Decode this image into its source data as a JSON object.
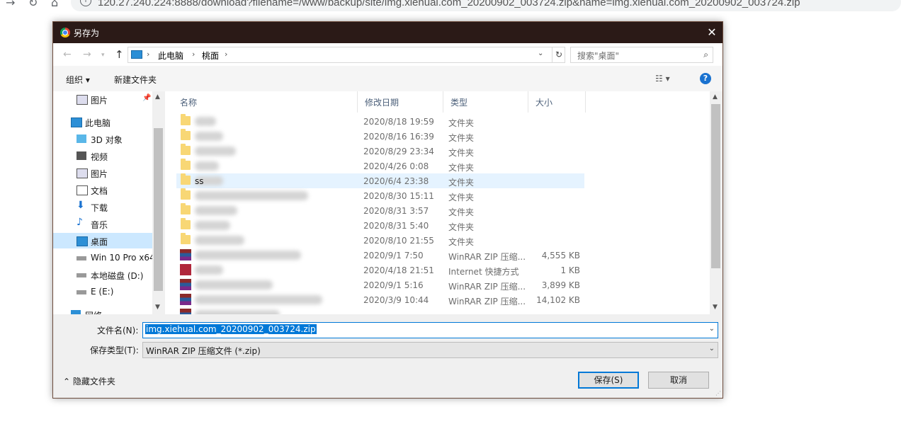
{
  "browser": {
    "url": "120.27.240.224:8888/download?filename=/www/backup/site/img.xiehual.com_20200902_003724.zip&name=img.xiehual.com_20200902_003724.zip",
    "info_icon": "i"
  },
  "dialog": {
    "title": "另存为",
    "close": "✕"
  },
  "address": {
    "crumbs": [
      "此电脑",
      "桃面"
    ],
    "search_placeholder": "搜索\"桌面\""
  },
  "toolbar": {
    "organize": "组织 ▾",
    "new_folder": "新建文件夹"
  },
  "nav": {
    "items": [
      {
        "label": "图片",
        "icon": "pictures-icon",
        "pinned": true
      },
      {
        "label": "此电脑",
        "icon": "computer-icon"
      },
      {
        "label": "3D 对象",
        "icon": "3d-objects-icon"
      },
      {
        "label": "视频",
        "icon": "video-icon"
      },
      {
        "label": "图片",
        "icon": "pictures-icon"
      },
      {
        "label": "文档",
        "icon": "documents-icon"
      },
      {
        "label": "下载",
        "icon": "download-icon"
      },
      {
        "label": "音乐",
        "icon": "music-icon"
      },
      {
        "label": "桌面",
        "icon": "desktop-icon",
        "selected": true
      },
      {
        "label": "Win 10 Pro x64",
        "icon": "drive-icon"
      },
      {
        "label": "本地磁盘 (D:)",
        "icon": "drive-icon"
      },
      {
        "label": "E (E:)",
        "icon": "drive-icon"
      },
      {
        "label": "网络",
        "icon": "network-icon"
      }
    ]
  },
  "columns": {
    "name": "名称",
    "modified": "修改日期",
    "type": "类型",
    "size": "大小"
  },
  "files": [
    {
      "icon": "folder-icon",
      "name": "",
      "modified": "2020/8/18 19:59",
      "type": "文件夹",
      "size": ""
    },
    {
      "icon": "folder-icon",
      "name": "",
      "modified": "2020/8/16 16:39",
      "type": "文件夹",
      "size": ""
    },
    {
      "icon": "folder-icon",
      "name": "",
      "modified": "2020/8/29 23:34",
      "type": "文件夹",
      "size": ""
    },
    {
      "icon": "folder-icon",
      "name": "",
      "modified": "2020/4/26 0:08",
      "type": "文件夹",
      "size": ""
    },
    {
      "icon": "folder-icon",
      "name": "ss",
      "modified": "2020/6/4 23:38",
      "type": "文件夹",
      "size": "",
      "hover": true
    },
    {
      "icon": "folder-icon",
      "name": "",
      "modified": "2020/8/30 15:11",
      "type": "文件夹",
      "size": ""
    },
    {
      "icon": "folder-icon",
      "name": "",
      "modified": "2020/8/31 3:57",
      "type": "文件夹",
      "size": ""
    },
    {
      "icon": "folder-icon",
      "name": "",
      "modified": "2020/8/31 5:40",
      "type": "文件夹",
      "size": ""
    },
    {
      "icon": "folder-icon",
      "name": "",
      "modified": "2020/8/10 21:55",
      "type": "文件夹",
      "size": ""
    },
    {
      "icon": "rar-icon",
      "name": "",
      "modified": "2020/9/1 7:50",
      "type": "WinRAR ZIP 压缩...",
      "size": "4,555 KB"
    },
    {
      "icon": "url-icon",
      "name": "",
      "modified": "2020/4/18 21:51",
      "type": "Internet 快捷方式",
      "size": "1 KB"
    },
    {
      "icon": "rar-icon",
      "name": "",
      "modified": "2020/9/1 5:16",
      "type": "WinRAR ZIP 压缩...",
      "size": "3,899 KB"
    },
    {
      "icon": "rar-icon",
      "name": "",
      "modified": "2020/3/9 10:44",
      "type": "WinRAR ZIP 压缩...",
      "size": "14,102 KB"
    },
    {
      "icon": "rar-icon",
      "name": "",
      "modified": "",
      "type": "",
      "size": ""
    }
  ],
  "form": {
    "filename_label": "文件名(N):",
    "filename_value": "img.xiehual.com_20200902_003724.zip",
    "filetype_label": "保存类型(T):",
    "filetype_value": "WinRAR ZIP 压缩文件 (*.zip)",
    "hide_folders": "隐藏文件夹",
    "save": "保存(S)",
    "cancel": "取消"
  }
}
